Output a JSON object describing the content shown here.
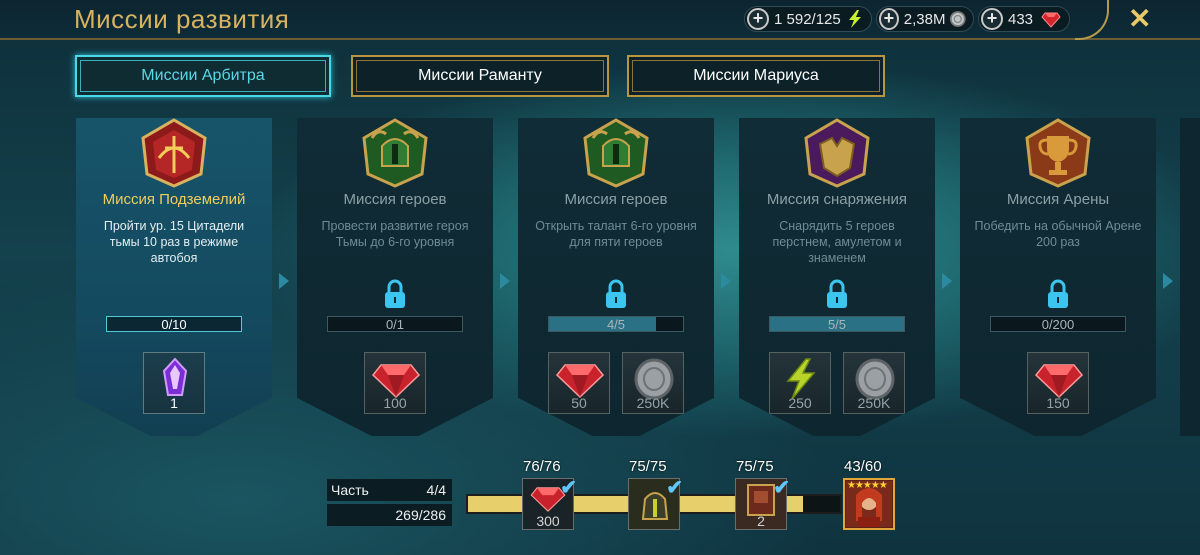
{
  "header": {
    "title": "Миссии развития",
    "resources": [
      {
        "value": "1 592/125",
        "icon": "energy-icon"
      },
      {
        "value": "2,38M",
        "icon": "silver-coin-icon"
      },
      {
        "value": "433",
        "icon": "ruby-gem-icon"
      }
    ],
    "plus": "+",
    "close": "✕"
  },
  "tabs": [
    {
      "label": "Миссии Арбитра",
      "active": true
    },
    {
      "label": "Миссии Раманту",
      "active": false
    },
    {
      "label": "Миссии Мариуса",
      "active": false
    }
  ],
  "missions": [
    {
      "name": "Миссия Подземелий",
      "description": "Пройти ур. 15 Цитадели тьмы 10 раз в режиме автобоя",
      "progress": "0/10",
      "progress_fraction": 0.0,
      "locked": false,
      "emblem": "dungeon-emblem-icon",
      "rewards": [
        {
          "icon": "purple-artifact-icon",
          "amount": "1"
        }
      ]
    },
    {
      "name": "Миссия героев",
      "description": "Провести развитие героя Тьмы до 6-го уровня",
      "progress": "0/1",
      "progress_fraction": 0.0,
      "locked": true,
      "emblem": "hero-helmet-emblem-icon",
      "rewards": [
        {
          "icon": "ruby-gem-icon",
          "amount": "100"
        }
      ]
    },
    {
      "name": "Миссия героев",
      "description": "Открыть талант 6-го уровня для пяти героев",
      "progress": "4/5",
      "progress_fraction": 0.8,
      "locked": true,
      "emblem": "hero-helmet-emblem-icon",
      "rewards": [
        {
          "icon": "ruby-gem-icon",
          "amount": "50"
        },
        {
          "icon": "silver-coin-icon",
          "amount": "250K"
        }
      ]
    },
    {
      "name": "Миссия снаряжения",
      "description": "Снарядить 5 героев перстнем, амулетом и знаменем",
      "progress": "5/5",
      "progress_fraction": 1.0,
      "locked": true,
      "emblem": "armor-emblem-icon",
      "rewards": [
        {
          "icon": "energy-icon",
          "amount": "250"
        },
        {
          "icon": "silver-coin-icon",
          "amount": "250K"
        }
      ]
    },
    {
      "name": "Миссия Арены",
      "description": "Победить на обычной Арене 200 раз",
      "progress": "0/200",
      "progress_fraction": 0.0,
      "locked": true,
      "emblem": "trophy-emblem-icon",
      "rewards": [
        {
          "icon": "ruby-gem-icon",
          "amount": "150"
        }
      ]
    }
  ],
  "part": {
    "label": "Часть",
    "value": "4/4",
    "points": "269/286"
  },
  "overall_progress_fraction": 0.9,
  "milestones": [
    {
      "label": "76/76",
      "icon": "ruby-gem-icon",
      "amount": "300",
      "done": true
    },
    {
      "label": "75/75",
      "icon": "artifact-helmet-icon",
      "amount": "",
      "done": true
    },
    {
      "label": "75/75",
      "icon": "skill-tome-icon",
      "amount": "2",
      "done": true
    },
    {
      "label": "43/60",
      "icon": "hero-portrait-icon",
      "amount": "",
      "done": false
    }
  ],
  "colors": {
    "gold": "#d8b25e",
    "cyan": "#49d8e6",
    "ruby": "#d0303a"
  }
}
